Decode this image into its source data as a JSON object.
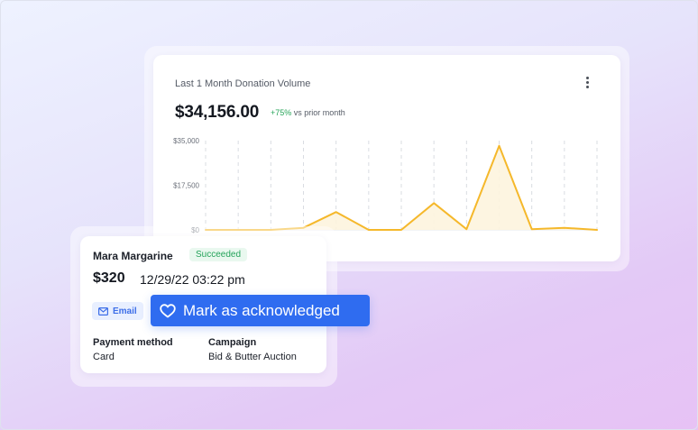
{
  "chart_card": {
    "title": "Last 1 Month Donation Volume",
    "total": "$34,156.00",
    "delta_value": "+75%",
    "delta_suffix": "vs prior month",
    "menu_icon": "kebab-menu-icon"
  },
  "chart_data": {
    "type": "area",
    "title": "Last 1 Month Donation Volume",
    "y_ticks": [
      "$35,000",
      "$17,500",
      "$0"
    ],
    "ylim": [
      0,
      35000
    ],
    "x": [
      1,
      2,
      3,
      4,
      5,
      6,
      7,
      8,
      9,
      10,
      11,
      12,
      13
    ],
    "series": [
      {
        "values": [
          0,
          0,
          0,
          800,
          7000,
          0,
          0,
          10500,
          300,
          33000,
          300,
          800,
          0
        ]
      }
    ],
    "grid": "vertical-dashed",
    "colors": {
      "line": "#f5b82b",
      "fill": "#fdf4de"
    }
  },
  "payment": {
    "donor": "Mara Margarine",
    "status": "Succeeded",
    "amount": "$320",
    "datetime": "12/29/22 03:22 pm",
    "email_label": "Email",
    "payment_method_label": "Payment method",
    "payment_method_value": "Card",
    "campaign_label": "Campaign",
    "campaign_value": "Bid & Butter Auction",
    "status_color": "#24a35a"
  },
  "ack_button": {
    "label": "Mark as acknowledged",
    "icon": "heart-icon",
    "color": "#2f6cf0"
  }
}
